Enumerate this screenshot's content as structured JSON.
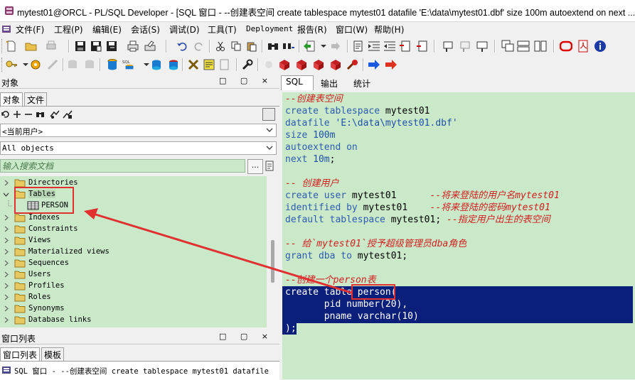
{
  "window": {
    "title": "mytest01@ORCL - PL/SQL Developer - [SQL 窗口 - --创建表空间 create tablespace mytest01 datafile 'E:\\data\\mytest01.dbf' size 100m autoextend on next ...]"
  },
  "menu": [
    {
      "label": "文件(F)"
    },
    {
      "label": "工程(P)"
    },
    {
      "label": "编辑(E)"
    },
    {
      "label": "会话(S)"
    },
    {
      "label": "调试(D)"
    },
    {
      "label": "工具(T)"
    },
    {
      "label": "Deployment"
    },
    {
      "label": "报告(R)"
    },
    {
      "label": "窗口(W)"
    },
    {
      "label": "帮助(H)"
    }
  ],
  "left_panel": {
    "header_title": "对象",
    "header_buttons": "□ ▢ ×",
    "tabs": [
      {
        "label": "对象"
      },
      {
        "label": "文件"
      }
    ],
    "user_combo": "<当前用户>",
    "filter_combo": "All objects",
    "search_placeholder": "输入搜索文档",
    "tree": [
      {
        "label": "Directories",
        "expanded": false
      },
      {
        "label": "Tables",
        "expanded": true
      },
      {
        "label": "PERSON",
        "child": true
      },
      {
        "label": "Indexes",
        "expanded": false
      },
      {
        "label": "Constraints",
        "expanded": false
      },
      {
        "label": "Views",
        "expanded": false
      },
      {
        "label": "Materialized views",
        "expanded": false
      },
      {
        "label": "Sequences",
        "expanded": false
      },
      {
        "label": "Users",
        "expanded": false
      },
      {
        "label": "Profiles",
        "expanded": false
      },
      {
        "label": "Roles",
        "expanded": false
      },
      {
        "label": "Synonyms",
        "expanded": false
      },
      {
        "label": "Database links",
        "expanded": false
      }
    ]
  },
  "window_list": {
    "header_title": "窗口列表",
    "tabs": [
      {
        "label": "窗口列表"
      },
      {
        "label": "模板"
      }
    ],
    "item": "SQL 窗口 - --创建表空间 create tablespace mytest01 datafile"
  },
  "editor": {
    "tabs": [
      {
        "label": "SQL"
      },
      {
        "label": "输出"
      },
      {
        "label": "统计"
      }
    ],
    "lines": {
      "l1": "--创建表空间",
      "l2a": "create tablespace",
      "l2b": " mytest01",
      "l3a": "datafile ",
      "l3b": "'E:\\data\\mytest01.dbf'",
      "l4a": "size ",
      "l4b": "100m",
      "l5a": "autoextend on",
      "l6a": "next ",
      "l6b": "10m",
      "l6c": ";",
      "l8": "-- 创建用户",
      "l9a": "create user",
      "l9b": " mytest01",
      "l9c": "      --将来登陆的用户名mytest01",
      "l10a": "identified by",
      "l10b": " mytest01",
      "l10c": "    --将来登陆的密码mytest01",
      "l11a": "default tablespace",
      "l11b": " mytest01;",
      "l11c": " --指定用户出生的表空间",
      "l13": "-- 给`mytest01`授予超级管理员dba角色",
      "l14a": "grant dba to",
      "l14b": " mytest01;",
      "l16": "--创建一个person表",
      "s1": "create table person(",
      "s2": "       pid number(20),",
      "s3": "       pname varchar(10)",
      "s4": ");"
    }
  },
  "colors": {
    "editor_bg": "#c9e9c9",
    "selection_bg": "#0a1f7a",
    "comment": "#d21f1f",
    "keyword": "#2e5cb0",
    "annotation_red": "#e03030"
  }
}
